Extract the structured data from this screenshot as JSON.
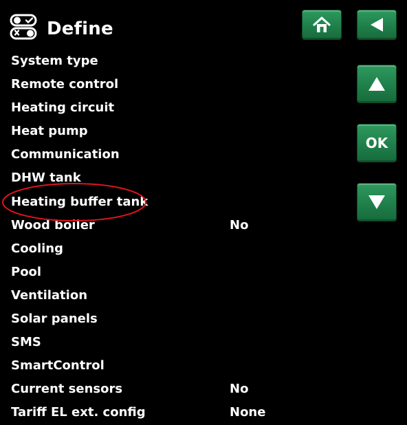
{
  "header": {
    "title": "Define",
    "icon": "toggle-switches-icon"
  },
  "nav": {
    "home_icon": "home-icon",
    "back_icon": "back-arrow-icon",
    "up_icon": "up-arrow-icon",
    "ok_label": "OK",
    "down_icon": "down-arrow-icon",
    "button_color": "#1f8a50"
  },
  "menu": {
    "items": [
      {
        "label": "System type",
        "value": ""
      },
      {
        "label": "Remote control",
        "value": ""
      },
      {
        "label": "Heating circuit",
        "value": ""
      },
      {
        "label": "Heat pump",
        "value": ""
      },
      {
        "label": "Communication",
        "value": ""
      },
      {
        "label": "DHW tank",
        "value": ""
      },
      {
        "label": "Heating buffer tank",
        "value": ""
      },
      {
        "label": "Wood boiler",
        "value": "No"
      },
      {
        "label": "Cooling",
        "value": ""
      },
      {
        "label": "Pool",
        "value": ""
      },
      {
        "label": "Ventilation",
        "value": ""
      },
      {
        "label": "Solar panels",
        "value": ""
      },
      {
        "label": "SMS",
        "value": ""
      },
      {
        "label": "SmartControl",
        "value": ""
      },
      {
        "label": "Current sensors",
        "value": "No"
      },
      {
        "label": "Tariff EL ext. config",
        "value": "None"
      }
    ]
  },
  "annotation": {
    "color": "#e0141e"
  }
}
